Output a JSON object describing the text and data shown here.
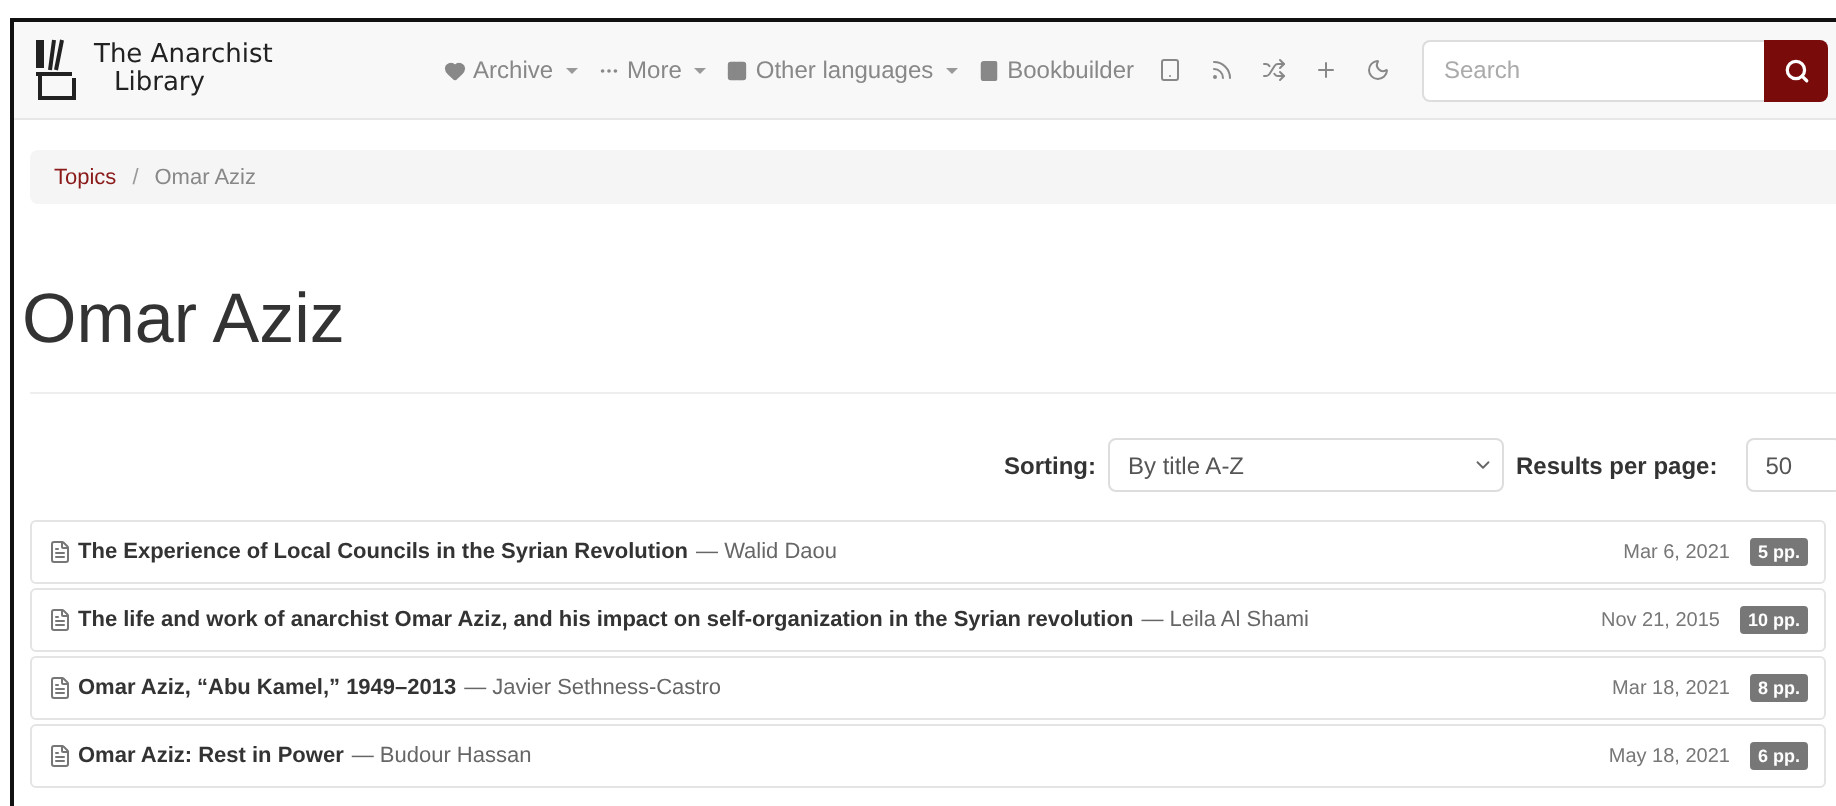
{
  "logo": {
    "line_1": "The Anarchist",
    "line_2": "Library"
  },
  "nav": [
    {
      "label": "Archive",
      "kind": "dropdown"
    },
    {
      "label": "More",
      "kind": "dropdown"
    },
    {
      "label": "Other languages",
      "kind": "dropdown"
    },
    {
      "label": "Bookbuilder",
      "kind": "link"
    },
    {
      "kind": "icon"
    },
    {
      "kind": "icon"
    },
    {
      "kind": "icon"
    },
    {
      "kind": "icon"
    },
    {
      "kind": "icon"
    }
  ],
  "search": {
    "placeholder": "Search"
  },
  "breadcrumb": [
    {
      "label": "Topics",
      "kind": "link"
    },
    {
      "label": "/",
      "kind": "separator"
    },
    {
      "label": "Omar Aziz",
      "kind": "current"
    }
  ],
  "title": "Omar Aziz",
  "sorting": {
    "label": "Sorting:",
    "value": "By title A-Z"
  },
  "per_page": {
    "label": "Results per page:",
    "value": "50"
  },
  "texts": [
    {
      "title": "The Experience of Local Councils in the Syrian Revolution",
      "author": "— Walid Daou",
      "date": "Mar 6, 2021",
      "pages": "5 pp."
    },
    {
      "title": "The life and work of anarchist Omar Aziz, and his impact on self-organization in the Syrian revolution",
      "author": "— Leila Al Shami",
      "date": "Nov 21, 2015",
      "pages": "10 pp."
    },
    {
      "title": "Omar Aziz, “Abu Kamel,” 1949–2013",
      "author": "— Javier Sethness-Castro",
      "date": "Mar 18, 2021",
      "pages": "8 pp."
    },
    {
      "title": "Omar Aziz: Rest in Power",
      "author": "— Budour Hassan",
      "date": "May 18, 2021",
      "pages": "6 pp."
    }
  ]
}
